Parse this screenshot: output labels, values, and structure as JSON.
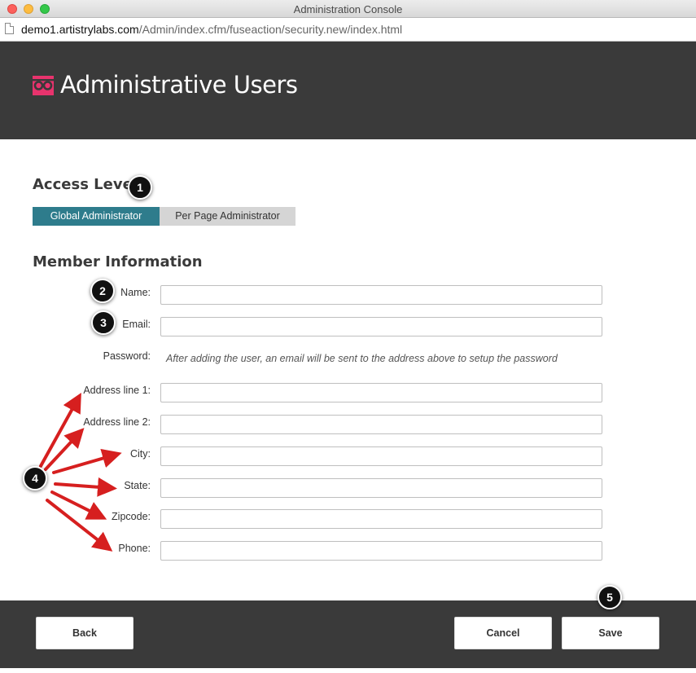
{
  "window": {
    "title": "Administration Console",
    "url_host": "demo1.artistrylabs.com",
    "url_path": "/Admin/index.cfm/fuseaction/security.new/index.html"
  },
  "header": {
    "logo_icon": "link-infinity-icon",
    "title": "Administrative Users",
    "logo_color": "#e8336d"
  },
  "access": {
    "title": "Access Level",
    "options": [
      "Global Administrator",
      "Per Page Administrator"
    ],
    "selected": "Global Administrator",
    "accent": "#2e7c8c"
  },
  "member": {
    "title": "Member Information",
    "fields": {
      "name": {
        "label": "Name:",
        "value": ""
      },
      "email": {
        "label": "Email:",
        "value": ""
      },
      "password": {
        "label": "Password:",
        "note": "After adding the user, an email will be sent to the address above to setup the password"
      },
      "address1": {
        "label": "Address line 1:",
        "value": ""
      },
      "address2": {
        "label": "Address line 2:",
        "value": ""
      },
      "city": {
        "label": "City:",
        "value": ""
      },
      "state": {
        "label": "State:",
        "value": ""
      },
      "zipcode": {
        "label": "Zipcode:",
        "value": ""
      },
      "phone": {
        "label": "Phone:",
        "value": ""
      }
    }
  },
  "footer": {
    "back": "Back",
    "cancel": "Cancel",
    "save": "Save"
  },
  "callouts": [
    "1",
    "2",
    "3",
    "4",
    "5"
  ]
}
